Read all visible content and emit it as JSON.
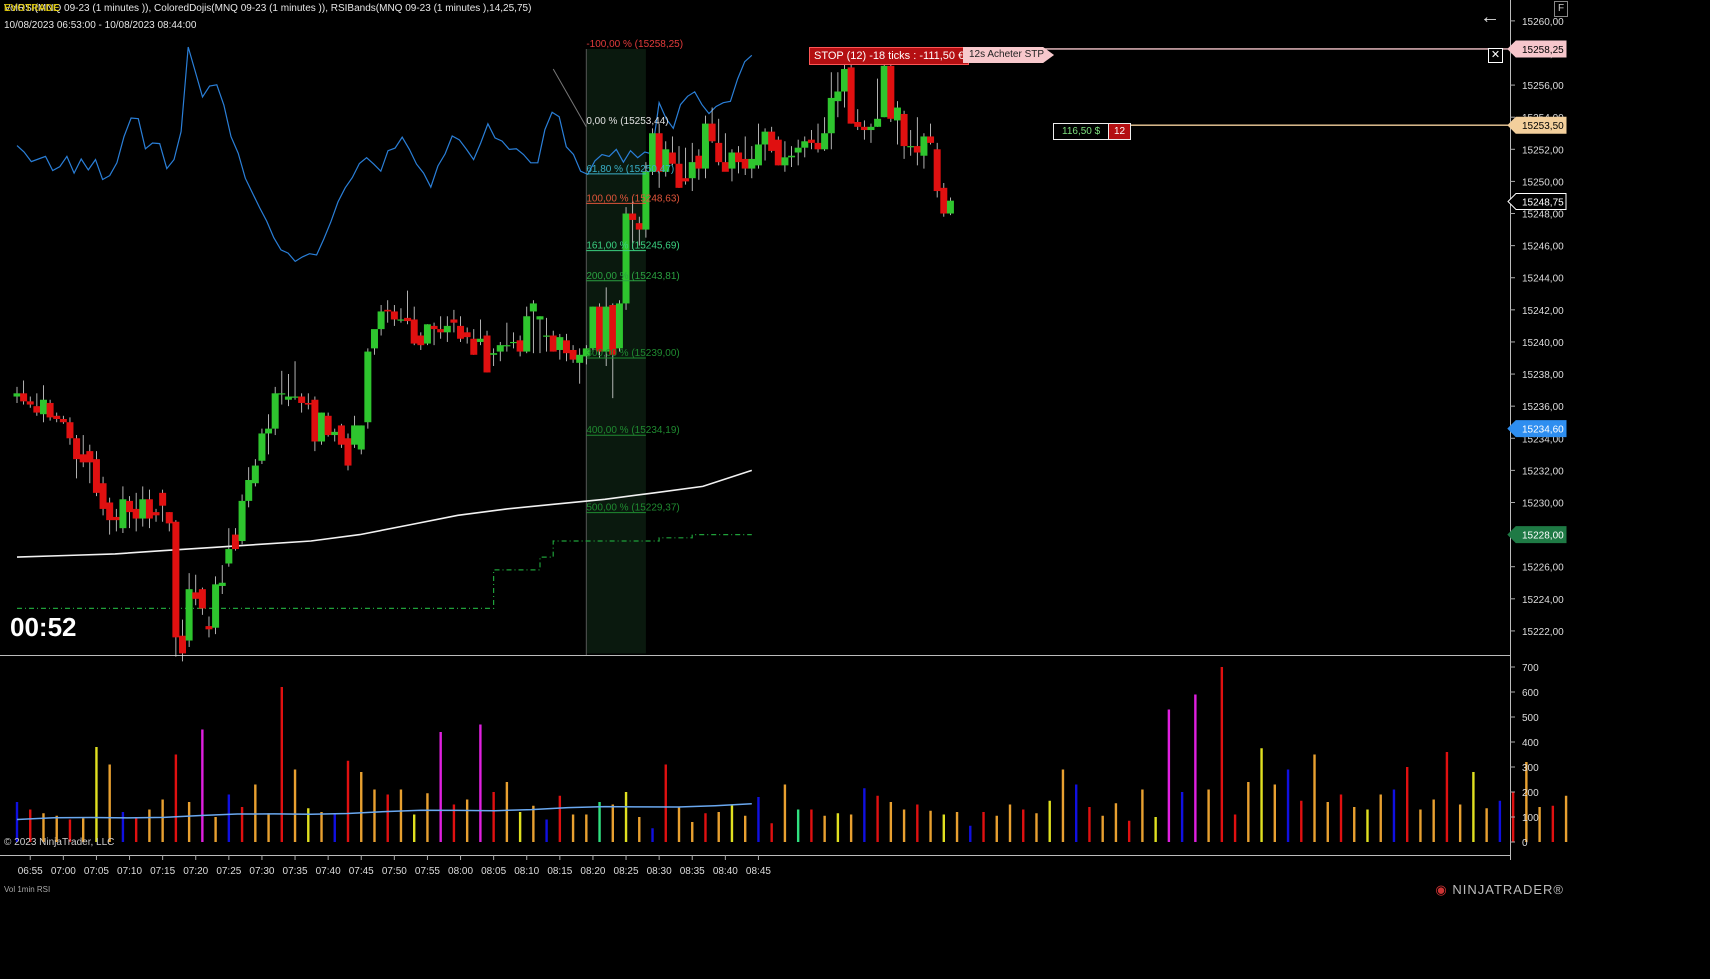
{
  "header": {
    "title_overlay": "EVOTRADE",
    "indicators_line": "VolRSI(MNQ 09-23 (1 minutes )), ColoredDojis(MNQ 09-23 (1 minutes )), RSIBands(MNQ 09-23 (1 minutes ),14,25,75)",
    "date_range": "10/08/2023 06:53:00 - 10/08/2023 08:44:00"
  },
  "timer": "00:52",
  "copyright": "© 2023 NinjaTrader, LLC",
  "volume_panel_label": "Vol 1min RSI",
  "brand": "NINJATRADER",
  "brand_mark": "®",
  "buttons": {
    "back": "←",
    "float": "F",
    "close_stop": "✕"
  },
  "orders": {
    "stop_label": "STOP (12) -18 ticks : -111,50 €",
    "stop_order_tag": "12s  Acheter STP",
    "position_pnl": "116,50 $",
    "position_qty": "12"
  },
  "price_axis": {
    "min": 15220.5,
    "max": 15261.3,
    "ticks": [
      15222,
      15224,
      15226,
      15228,
      15230,
      15232,
      15234,
      15236,
      15238,
      15240,
      15242,
      15244,
      15246,
      15248,
      15250,
      15252,
      15254,
      15256,
      15258,
      15260
    ],
    "markers": [
      {
        "price": 15258.25,
        "label": "15258,25",
        "bg": "#f6c6cb",
        "fg": "#000000"
      },
      {
        "price": 15253.5,
        "label": "15253,50",
        "bg": "#f3cf9c",
        "fg": "#000000"
      },
      {
        "price": 15248.75,
        "label": "15248,75",
        "bg": "#000000",
        "fg": "#ffffff"
      },
      {
        "price": 15234.6,
        "label": "15234,60",
        "bg": "#2e8ef0",
        "fg": "#ffffff"
      },
      {
        "price": 15228.0,
        "label": "15228,00",
        "bg": "#1f7a45",
        "fg": "#ffffff"
      }
    ]
  },
  "volume_axis": {
    "min": 0,
    "max": 700,
    "ticks": [
      0,
      100,
      200,
      300,
      400,
      500,
      600,
      700
    ]
  },
  "time_axis": [
    "06:55",
    "07:00",
    "07:05",
    "07:10",
    "07:15",
    "07:20",
    "07:25",
    "07:30",
    "07:35",
    "07:40",
    "07:45",
    "07:50",
    "07:55",
    "08:00",
    "08:05",
    "08:10",
    "08:15",
    "08:20",
    "08:25",
    "08:30",
    "08:35",
    "08:40",
    "08:45"
  ],
  "fib_levels": [
    {
      "label": "-100,00 % (15258,25)",
      "price": 15258.25,
      "color": "#e23b3b"
    },
    {
      "label": "0,00 % (15253,44)",
      "price": 15253.44,
      "color": "#e0e0e0"
    },
    {
      "label": "61,80 % (15250,47)",
      "price": 15250.47,
      "color": "#3ab0c8"
    },
    {
      "label": "100,00 % (15248,63)",
      "price": 15248.63,
      "color": "#e0553a"
    },
    {
      "label": "161,00 % (15245,69)",
      "price": 15245.69,
      "color": "#3ad080"
    },
    {
      "label": "200,00 % (15243,81)",
      "price": 15243.81,
      "color": "#2aa040"
    },
    {
      "label": "300,00 % (15239,00)",
      "price": 15239.0,
      "color": "#1f8a30"
    },
    {
      "label": "400,00 % (15234,19)",
      "price": 15234.19,
      "color": "#1f8a30"
    },
    {
      "label": "500,00 % (15229,37)",
      "price": 15229.37,
      "color": "#1f8a30"
    }
  ],
  "colors": {
    "up": "#2ec52e",
    "down": "#e01010",
    "rsi_line": "#2a7fd8",
    "vwap_line": "#f2f2f2",
    "stop_line": "#f6c6cb",
    "position_line": "#f3cf9c",
    "support_dash": "#1fa03a",
    "vol_avg": "#6aa8f0"
  },
  "chart_data": {
    "type": "candlestick",
    "symbol": "MNQ 09-23",
    "timeframe": "1 minute",
    "start_time": "06:53",
    "ohlc": [
      [
        15236.6,
        15237.2,
        15236.2,
        15236.8
      ],
      [
        15236.8,
        15237.6,
        15236.1,
        15236.3
      ],
      [
        15236.3,
        15236.6,
        15235.9,
        15236.1
      ],
      [
        15236.0,
        15236.8,
        15235.4,
        15235.6
      ],
      [
        15235.5,
        15237.3,
        15235.0,
        15236.4
      ],
      [
        15236.2,
        15236.4,
        15235.1,
        15235.3
      ],
      [
        15235.4,
        15235.6,
        15235.0,
        15235.2
      ],
      [
        15235.2,
        15235.4,
        15234.9,
        15235.0
      ],
      [
        15235.0,
        15235.3,
        15233.6,
        15234.0
      ],
      [
        15234.0,
        15234.2,
        15231.5,
        15232.7
      ],
      [
        15233.0,
        15234.2,
        15232.2,
        15232.5
      ],
      [
        15233.2,
        15233.6,
        15231.2,
        15232.5
      ],
      [
        15232.7,
        15233.2,
        15230.4,
        15230.6
      ],
      [
        15231.2,
        15231.6,
        15229.2,
        15229.6
      ],
      [
        15230.0,
        15230.3,
        15228.0,
        15228.9
      ],
      [
        15229.1,
        15229.6,
        15228.2,
        15228.9
      ],
      [
        15228.4,
        15231.0,
        15228.1,
        15230.2
      ],
      [
        15230.1,
        15230.4,
        15228.4,
        15229.4
      ],
      [
        15229.6,
        15230.6,
        15228.2,
        15229.0
      ],
      [
        15229.0,
        15231.0,
        15228.5,
        15230.2
      ],
      [
        15230.2,
        15230.8,
        15228.4,
        15229.0
      ],
      [
        15229.4,
        15229.6,
        15228.8,
        15229.2
      ],
      [
        15230.6,
        15230.8,
        15228.8,
        15229.8
      ],
      [
        15229.4,
        15229.4,
        15228.2,
        15228.7
      ],
      [
        15228.8,
        15228.9,
        15220.4,
        15221.6
      ],
      [
        15221.7,
        15222.7,
        15220.1,
        15220.6
      ],
      [
        15221.4,
        15225.6,
        15221.0,
        15224.6
      ],
      [
        15224.4,
        15225.5,
        15223.6,
        15224.0
      ],
      [
        15224.6,
        15224.7,
        15223.0,
        15223.4
      ],
      [
        15222.3,
        15222.9,
        15221.6,
        15222.1
      ],
      [
        15222.2,
        15225.4,
        15221.8,
        15224.9
      ],
      [
        15224.8,
        15226.1,
        15224.3,
        15225.0
      ],
      [
        15226.2,
        15228.4,
        15226.0,
        15227.1
      ],
      [
        15228.0,
        15228.4,
        15227.0,
        15227.1
      ],
      [
        15227.6,
        15230.5,
        15227.4,
        15230.1
      ],
      [
        15230.1,
        15232.2,
        15229.7,
        15231.4
      ],
      [
        15231.2,
        15232.7,
        15231.0,
        15232.3
      ],
      [
        15232.6,
        15234.6,
        15232.4,
        15234.3
      ],
      [
        15234.3,
        15235.5,
        15233.0,
        15234.6
      ],
      [
        15234.6,
        15237.2,
        15234.2,
        15236.8
      ],
      [
        15236.8,
        15238.2,
        15236.1,
        15236.8
      ],
      [
        15236.4,
        15238.0,
        15236.0,
        15236.6
      ],
      [
        15236.6,
        15238.8,
        15236.4,
        15236.6
      ],
      [
        15236.6,
        15236.8,
        15235.6,
        15236.2
      ],
      [
        15236.2,
        15236.8,
        15235.8,
        15236.1
      ],
      [
        15236.4,
        15236.6,
        15233.2,
        15233.8
      ],
      [
        15233.8,
        15235.6,
        15233.6,
        15235.6
      ],
      [
        15235.4,
        15235.6,
        15234.1,
        15234.2
      ],
      [
        15234.2,
        15234.6,
        15233.8,
        15234.4
      ],
      [
        15234.8,
        15234.9,
        15233.4,
        15233.6
      ],
      [
        15234.0,
        15234.3,
        15232.0,
        15232.3
      ],
      [
        15233.6,
        15235.4,
        15233.4,
        15234.8
      ],
      [
        15233.3,
        15234.8,
        15233.0,
        15234.8
      ],
      [
        15235.0,
        15239.6,
        15234.6,
        15239.4
      ],
      [
        15239.6,
        15240.3,
        15239.2,
        15240.8
      ],
      [
        15240.8,
        15242.3,
        15240.4,
        15241.9
      ],
      [
        15242.0,
        15242.6,
        15241.2,
        15241.9
      ],
      [
        15241.9,
        15242.3,
        15241.0,
        15241.4
      ],
      [
        15241.4,
        15242.1,
        15241.2,
        15241.4
      ],
      [
        15241.5,
        15243.2,
        15241.1,
        15241.3
      ],
      [
        15241.4,
        15242.2,
        15239.8,
        15239.9
      ],
      [
        15240.4,
        15240.6,
        15239.5,
        15239.8
      ],
      [
        15239.9,
        15241.1,
        15239.8,
        15241.1
      ],
      [
        15241.0,
        15241.2,
        15239.8,
        15240.8
      ],
      [
        15240.8,
        15241.6,
        15240.2,
        15240.6
      ],
      [
        15240.6,
        15241.6,
        15240.0,
        15241.0
      ],
      [
        15241.4,
        15242.0,
        15240.6,
        15241.2
      ],
      [
        15241.0,
        15241.6,
        15240.0,
        15240.2
      ],
      [
        15240.6,
        15240.9,
        15239.9,
        15240.3
      ],
      [
        15240.2,
        15240.8,
        15239.2,
        15239.2
      ],
      [
        15240.0,
        15241.4,
        15239.8,
        15240.2
      ],
      [
        15240.4,
        15240.7,
        15238.1,
        15238.1
      ],
      [
        15239.2,
        15239.6,
        15238.5,
        15239.3
      ],
      [
        15239.4,
        15240.0,
        15238.8,
        15239.8
      ],
      [
        15239.8,
        15241.2,
        15239.4,
        15239.8
      ],
      [
        15240.0,
        15240.6,
        15239.6,
        15240.0
      ],
      [
        15240.1,
        15240.4,
        15239.1,
        15239.4
      ],
      [
        15239.4,
        15242.2,
        15239.3,
        15241.6
      ],
      [
        15241.9,
        15242.6,
        15239.3,
        15242.4
      ],
      [
        15241.4,
        15241.6,
        15239.3,
        15241.6
      ],
      [
        15240.4,
        15241.5,
        15239.4,
        15240.4
      ],
      [
        15240.4,
        15240.7,
        15239.4,
        15239.4
      ],
      [
        15239.5,
        15240.5,
        15238.9,
        15240.3
      ],
      [
        15240.1,
        15240.5,
        15238.8,
        15239.3
      ],
      [
        15239.5,
        15239.8,
        15238.7,
        15238.9
      ],
      [
        15238.7,
        15239.6,
        15237.4,
        15239.2
      ],
      [
        15239.1,
        15239.8,
        15238.6,
        15239.6
      ],
      [
        15239.6,
        15242.2,
        15239.4,
        15242.2
      ],
      [
        15242.2,
        15242.4,
        15239.0,
        15239.4
      ],
      [
        15239.4,
        15243.4,
        15238.5,
        15242.2
      ],
      [
        15242.3,
        15242.4,
        15236.5,
        15239.2
      ],
      [
        15239.6,
        15242.6,
        15239.4,
        15242.4
      ],
      [
        15242.4,
        15248.4,
        15242.0,
        15248.0
      ],
      [
        15248.0,
        15248.8,
        15245.8,
        15247.6
      ],
      [
        15247.4,
        15247.8,
        15246.0,
        15247.0
      ],
      [
        15247.0,
        15251.2,
        15246.5,
        15250.6
      ],
      [
        15250.6,
        15253.3,
        15250.4,
        15253.0
      ],
      [
        15253.0,
        15253.6,
        15249.6,
        15250.6
      ],
      [
        15250.6,
        15252.5,
        15250.3,
        15252.0
      ],
      [
        15251.8,
        15252.8,
        15251.0,
        15251.1
      ],
      [
        15251.1,
        15252.2,
        15249.6,
        15249.6
      ],
      [
        15250.2,
        15252.1,
        15249.8,
        15250.0
      ],
      [
        15250.2,
        15252.4,
        15249.4,
        15251.2
      ],
      [
        15251.6,
        15252.0,
        15250.1,
        15250.8
      ],
      [
        15250.8,
        15254.1,
        15250.2,
        15253.6
      ],
      [
        15253.6,
        15254.6,
        15252.4,
        15252.5
      ],
      [
        15252.4,
        15253.9,
        15251.0,
        15251.2
      ],
      [
        15251.2,
        15253.0,
        15250.7,
        15250.6
      ],
      [
        15250.8,
        15252.0,
        15250.0,
        15251.8
      ],
      [
        15251.8,
        15252.2,
        15250.5,
        15251.2
      ],
      [
        15251.4,
        15252.8,
        15250.4,
        15250.8
      ],
      [
        15250.8,
        15252.2,
        15250.2,
        15251.4
      ],
      [
        15251.0,
        15253.6,
        15250.8,
        15252.3
      ],
      [
        15252.3,
        15253.3,
        15251.3,
        15253.1
      ],
      [
        15253.1,
        15253.4,
        15251.8,
        15251.9
      ],
      [
        15252.6,
        15252.8,
        15251.0,
        15251.0
      ],
      [
        15251.0,
        15252.5,
        15250.6,
        15251.5
      ],
      [
        15251.5,
        15252.2,
        15250.9,
        15251.6
      ],
      [
        15251.8,
        15252.6,
        15251.0,
        15252.1
      ],
      [
        15252.1,
        15252.8,
        15251.5,
        15252.5
      ],
      [
        15252.6,
        15253.2,
        15252.0,
        15252.4
      ],
      [
        15252.4,
        15253.6,
        15251.8,
        15252.0
      ],
      [
        15252.0,
        15254.0,
        15251.9,
        15253.0
      ],
      [
        15253.0,
        15256.8,
        15252.0,
        15255.2
      ],
      [
        15255.0,
        15256.8,
        15254.0,
        15255.6
      ],
      [
        15255.6,
        15257.5,
        15254.6,
        15257.0
      ],
      [
        15257.1,
        15257.4,
        15253.6,
        15253.6
      ],
      [
        15253.7,
        15254.5,
        15253.2,
        15253.4
      ],
      [
        15253.4,
        15253.8,
        15252.6,
        15253.2
      ],
      [
        15253.2,
        15253.6,
        15252.4,
        15253.4
      ],
      [
        15253.4,
        15256.4,
        15253.4,
        15253.9
      ],
      [
        15254.0,
        15257.7,
        15254.0,
        15257.2
      ],
      [
        15257.2,
        15257.5,
        15253.7,
        15253.9
      ],
      [
        15253.8,
        15255.0,
        15252.3,
        15254.6
      ],
      [
        15254.2,
        15254.4,
        15251.4,
        15252.2
      ],
      [
        15252.2,
        15253.2,
        15251.6,
        15252.2
      ],
      [
        15252.2,
        15254.0,
        15251.0,
        15251.8
      ],
      [
        15251.6,
        15253.0,
        15250.8,
        15252.8
      ],
      [
        15252.8,
        15253.6,
        15252.3,
        15252.4
      ],
      [
        15252.0,
        15252.4,
        15249.0,
        15249.4
      ],
      [
        15249.6,
        15249.9,
        15247.8,
        15248.0
      ],
      [
        15248.0,
        15249.0,
        15247.9,
        15248.8
      ]
    ],
    "volume_sample_every_2_bars": [
      160,
      130,
      115,
      105,
      90,
      95,
      380,
      310,
      120,
      100,
      130,
      170,
      350,
      160,
      450,
      100,
      190,
      140,
      230,
      115,
      620,
      290,
      135,
      120,
      115,
      325,
      280,
      210,
      190,
      210,
      110,
      195,
      440,
      150,
      170,
      470,
      200,
      240,
      120,
      145,
      90,
      185,
      110,
      110,
      160,
      150,
      200,
      100,
      55,
      310,
      140,
      80,
      115,
      120,
      150,
      105,
      180,
      75,
      230,
      130,
      130,
      105,
      115,
      110,
      215,
      185,
      160,
      130,
      150,
      125,
      110,
      120,
      65,
      120,
      105,
      150,
      130,
      115,
      165,
      290,
      230,
      140,
      105,
      155,
      85,
      210,
      100,
      530,
      200,
      590,
      210,
      700,
      110,
      240,
      375,
      230,
      290,
      165,
      350,
      160,
      190,
      140,
      130,
      190,
      210,
      300,
      130,
      170,
      360,
      150,
      280,
      135,
      165,
      200,
      320,
      140,
      145,
      185,
      330,
      110,
      160,
      200,
      290,
      175,
      185,
      140,
      200,
      105,
      215,
      155,
      170,
      130,
      100,
      170,
      180,
      130,
      155,
      110,
      185,
      65,
      160,
      175,
      150,
      105
    ],
    "rsi_scale": {
      "min": 0,
      "max": 100
    },
    "rsi_values_normalized": [
      0.796,
      0.786,
      0.771,
      0.775,
      0.779,
      0.757,
      0.763,
      0.779,
      0.753,
      0.775,
      0.758,
      0.774,
      0.743,
      0.749,
      0.769,
      0.81,
      0.839,
      0.838,
      0.791,
      0.8,
      0.799,
      0.76,
      0.774,
      0.818,
      0.95,
      0.911,
      0.872,
      0.889,
      0.891,
      0.859,
      0.81,
      0.784,
      0.745,
      0.722,
      0.699,
      0.678,
      0.652,
      0.633,
      0.628,
      0.615,
      0.622,
      0.627,
      0.625,
      0.65,
      0.677,
      0.708,
      0.73,
      0.746,
      0.768,
      0.777,
      0.767,
      0.756,
      0.788,
      0.792,
      0.809,
      0.79,
      0.767,
      0.753,
      0.731,
      0.764,
      0.783,
      0.811,
      0.805,
      0.79,
      0.774,
      0.8,
      0.83,
      0.808,
      0.803,
      0.79,
      0.791,
      0.782,
      0.769,
      0.769,
      0.821,
      0.848,
      0.841,
      0.794,
      0.782,
      0.756,
      0.751,
      0.772,
      0.782,
      0.779,
      0.79,
      0.77,
      0.788,
      0.777,
      0.786,
      0.783,
      0.863,
      0.838,
      0.823,
      0.86,
      0.873,
      0.88,
      0.86,
      0.846,
      0.857,
      0.863,
      0.865,
      0.9,
      0.927,
      0.937
    ],
    "vwap_values": [
      15226.6,
      15226.7,
      15226.8,
      15227.0,
      15227.2,
      15227.4,
      15227.6,
      15228.0,
      15228.6,
      15229.2,
      15229.6,
      15229.9,
      15230.2,
      15230.6,
      15231.0,
      15232.0
    ],
    "support_levels": [
      {
        "from": "06:53",
        "to": "08:05",
        "price": 15223.4
      },
      {
        "from": "08:05",
        "to": "08:12",
        "price": 15225.8
      },
      {
        "from": "08:12",
        "to": "08:14",
        "price": 15226.6
      },
      {
        "from": "08:14",
        "to": "08:30",
        "price": 15227.6
      },
      {
        "from": "08:30",
        "to": "08:35",
        "price": 15227.8
      },
      {
        "from": "08:35",
        "to": "08:44",
        "price": 15228.0
      }
    ],
    "current_price": 15248.75,
    "stop_price": 15258.25,
    "position_entry": 15253.5
  }
}
